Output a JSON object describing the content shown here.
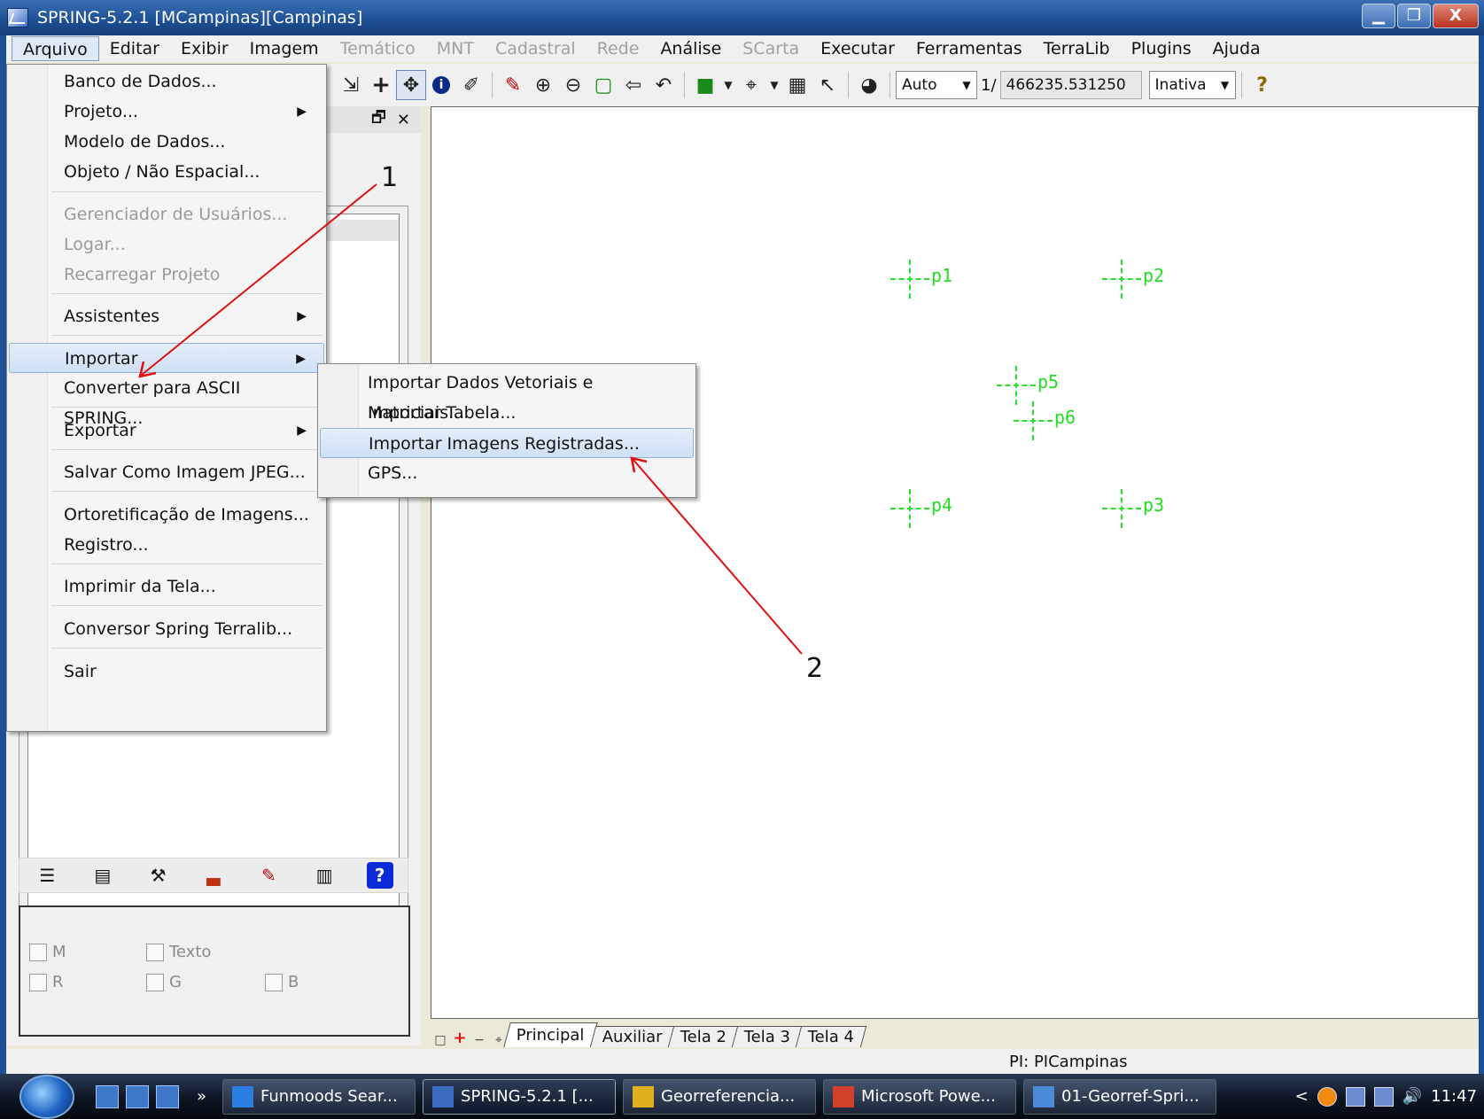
{
  "window": {
    "title": "SPRING-5.2.1 [MCampinas][Campinas]",
    "minimize": "▁",
    "maximize": "❐",
    "close": "X"
  },
  "menubar": [
    {
      "label": "Arquivo",
      "state": "active"
    },
    {
      "label": "Editar",
      "state": "enabled"
    },
    {
      "label": "Exibir",
      "state": "enabled"
    },
    {
      "label": "Imagem",
      "state": "enabled"
    },
    {
      "label": "Temático",
      "state": "disabled"
    },
    {
      "label": "MNT",
      "state": "disabled"
    },
    {
      "label": "Cadastral",
      "state": "disabled"
    },
    {
      "label": "Rede",
      "state": "disabled"
    },
    {
      "label": "Análise",
      "state": "enabled"
    },
    {
      "label": "SCarta",
      "state": "disabled"
    },
    {
      "label": "Executar",
      "state": "enabled"
    },
    {
      "label": "Ferramentas",
      "state": "enabled"
    },
    {
      "label": "TerraLib",
      "state": "enabled"
    },
    {
      "label": "Plugins",
      "state": "enabled"
    },
    {
      "label": "Ajuda",
      "state": "enabled"
    }
  ],
  "toolbar": {
    "scale_mode": "Auto",
    "scale_prefix": "1/",
    "scale_value": "466235.531250",
    "state": "Inativa",
    "icons": [
      "magnifier-icon",
      "go-to-icon",
      "crosshair-icon",
      "pan-icon",
      "info-icon",
      "tag-icon",
      "pencil-icon",
      "zoom-in-icon",
      "zoom-out-icon",
      "zoom-area-icon",
      "previous-view-icon",
      "undo-icon",
      "layers-icon",
      "cursor-settings-icon",
      "grid-icon",
      "select-cursor-icon",
      "palette-icon"
    ],
    "help_icon": "?"
  },
  "dock": {
    "float_icon": "🗗",
    "close_icon": "✕",
    "tools": [
      "list-icon",
      "table-icon",
      "edit-tool-icon",
      "chart-icon",
      "pencil-icon",
      "legend-icon",
      "?"
    ],
    "channels": [
      {
        "label": "M"
      },
      {
        "label": "Texto"
      },
      {
        "label": "R"
      },
      {
        "label": "G"
      },
      {
        "label": "B"
      }
    ]
  },
  "arquivo_menu": [
    {
      "label": "Banco de Dados...",
      "disabled": false,
      "submenu": false
    },
    {
      "label": "Projeto...",
      "disabled": false,
      "submenu": true
    },
    {
      "label": "Modelo de Dados...",
      "disabled": false,
      "submenu": false
    },
    {
      "label": "Objeto / Não Espacial...",
      "disabled": false,
      "submenu": false
    },
    {
      "label": "Gerenciador de Usuários...",
      "disabled": true,
      "submenu": false
    },
    {
      "label": "Logar...",
      "disabled": true,
      "submenu": false
    },
    {
      "label": "Recarregar Projeto",
      "disabled": true,
      "submenu": false
    },
    {
      "label": "Assistentes",
      "disabled": false,
      "submenu": true
    },
    {
      "label": "Importar",
      "disabled": false,
      "submenu": true,
      "highlighted": true
    },
    {
      "label": "Converter para ASCII SPRING...",
      "disabled": false,
      "submenu": false
    },
    {
      "label": "Exportar",
      "disabled": false,
      "submenu": true
    },
    {
      "label": "Salvar Como Imagem JPEG...",
      "disabled": false,
      "submenu": false
    },
    {
      "label": "Ortoretificação de Imagens...",
      "disabled": false,
      "submenu": false
    },
    {
      "label": "Registro...",
      "disabled": false,
      "submenu": false
    },
    {
      "label": "Imprimir da Tela...",
      "disabled": false,
      "submenu": false
    },
    {
      "label": "Conversor Spring Terralib...",
      "disabled": false,
      "submenu": false
    },
    {
      "label": "Sair",
      "disabled": false,
      "submenu": false
    }
  ],
  "importar_submenu": [
    {
      "label": "Importar Dados Vetoriais e Matriciais...",
      "highlighted": false
    },
    {
      "label": "Importar Tabela...",
      "highlighted": false
    },
    {
      "label": "Importar Imagens Registradas...",
      "highlighted": true
    },
    {
      "label": "GPS...",
      "highlighted": false
    }
  ],
  "canvas": {
    "points": [
      {
        "label": "p1"
      },
      {
        "label": "p2"
      },
      {
        "label": "p5"
      },
      {
        "label": "p6"
      },
      {
        "label": "p4"
      },
      {
        "label": "p3"
      }
    ]
  },
  "annotations": {
    "first": "1",
    "second": "2",
    "arrow_color": "#e01010"
  },
  "tabs": [
    {
      "label": "Principal",
      "active": true
    },
    {
      "label": "Auxiliar",
      "active": false
    },
    {
      "label": "Tela 2",
      "active": false
    },
    {
      "label": "Tela 3",
      "active": false
    },
    {
      "label": "Tela 4",
      "active": false
    }
  ],
  "status": {
    "pi": "PI: PICampinas"
  },
  "taskbar": {
    "quicklaunch_more": "»",
    "tasks": [
      {
        "label": "Funmoods Sear...",
        "active": false
      },
      {
        "label": "SPRING-5.2.1 [...",
        "active": true
      },
      {
        "label": "Georreferencia...",
        "active": false
      },
      {
        "label": "Microsoft Powe...",
        "active": false
      },
      {
        "label": "01-Georref-Spri...",
        "active": false
      }
    ],
    "tray_arrow": "<",
    "clock": "11:47"
  }
}
